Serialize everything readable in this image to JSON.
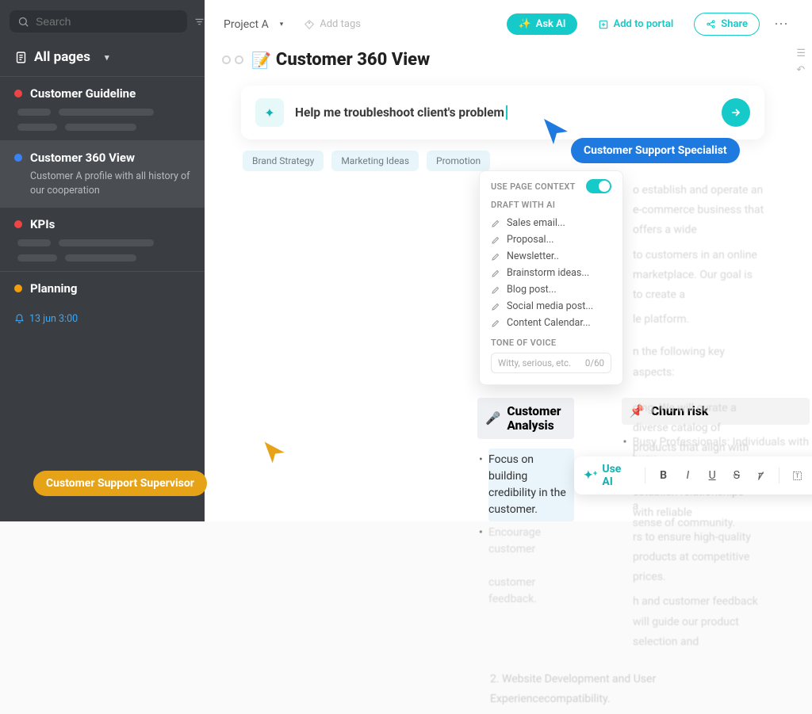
{
  "sidebar": {
    "search_placeholder": "Search",
    "page_button": "Page",
    "all_pages_label": "All pages",
    "items": [
      {
        "label": "Customer Guideline",
        "dot": "red",
        "subtitle": "",
        "skeletons": 2
      },
      {
        "label": "Customer 360 View",
        "dot": "blue",
        "subtitle": "Customer A profile with all history of our cooperation",
        "active": true
      },
      {
        "label": "KPIs",
        "dot": "red",
        "subtitle": "",
        "skeletons": 2
      },
      {
        "label": "Planning",
        "dot": "yellow",
        "subtitle": ""
      }
    ],
    "date_label": "13 jun 3:00"
  },
  "topbar": {
    "project": "Project A",
    "add_tags": "Add tags",
    "ask_ai": "Ask AI",
    "add_portal": "Add to portal",
    "share": "Share"
  },
  "page": {
    "emoji": "📝",
    "title": "Customer 360 View"
  },
  "ai": {
    "prompt": "Help me troubleshoot client's problem"
  },
  "chips": [
    "Brand Strategy",
    "Marketing Ideas",
    "Promotion"
  ],
  "roles": {
    "specialist": "Customer Support Specialist",
    "supervisor": "Customer Support Supervisor"
  },
  "dropdown": {
    "use_context": "USE PAGE CONTEXT",
    "draft_with": "DRAFT WITH AI",
    "items": [
      "Sales email...",
      "Proposal...",
      "Newsletter..",
      "Brainstorm ideas...",
      "Blog post...",
      "Social media post...",
      "Content Calendar..."
    ],
    "tone_label": "TONE OF VOICE",
    "tone_placeholder": "Witty, serious, etc.",
    "tone_counter": "0/60"
  },
  "sections": {
    "analysis": {
      "icon": "🎤",
      "title": "Customer Analysis",
      "bullet1": "Focus on building credibility in the customer."
    },
    "churn": {
      "icon": "📌",
      "title": "Churn risk"
    }
  },
  "toolbar": {
    "use_ai": "Use AI"
  },
  "colors": {
    "accent": "#17caca",
    "blue_role": "#1f7ae0",
    "yellow_role": "#e7a318"
  }
}
